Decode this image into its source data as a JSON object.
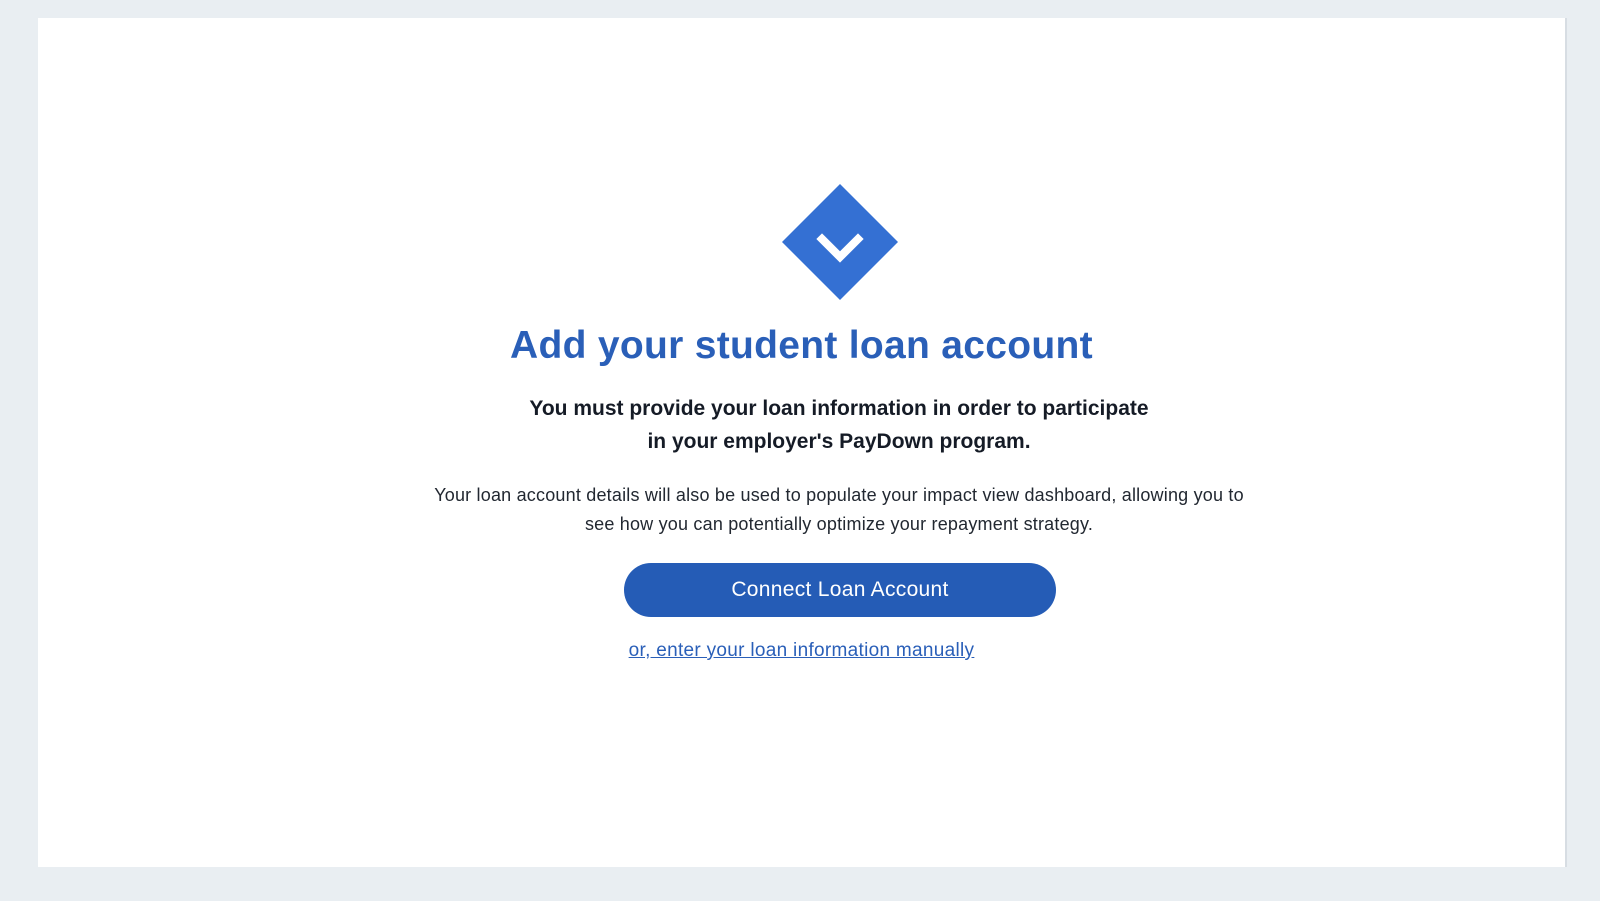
{
  "colors": {
    "page_background": "#e9eef2",
    "card_background": "#ffffff",
    "accent": "#2a5fb8",
    "button_background": "#255cb6",
    "button_text": "#ffffff",
    "body_text": "#151b26"
  },
  "logo": {
    "icon": "diamond-chevron-down-icon"
  },
  "heading": {
    "title": "Add your student loan account"
  },
  "message": {
    "requirement_line_1": "You must provide your loan information in order to participate",
    "requirement_line_2": "in your employer's PayDown program.",
    "details_line_1": "Your loan account details will also be used to populate your impact view dashboard, allowing you to",
    "details_line_2": "see how you can potentially optimize your repayment strategy."
  },
  "actions": {
    "connect_label": "Connect Loan Account",
    "manual_link_label": "or, enter your loan information manually"
  }
}
